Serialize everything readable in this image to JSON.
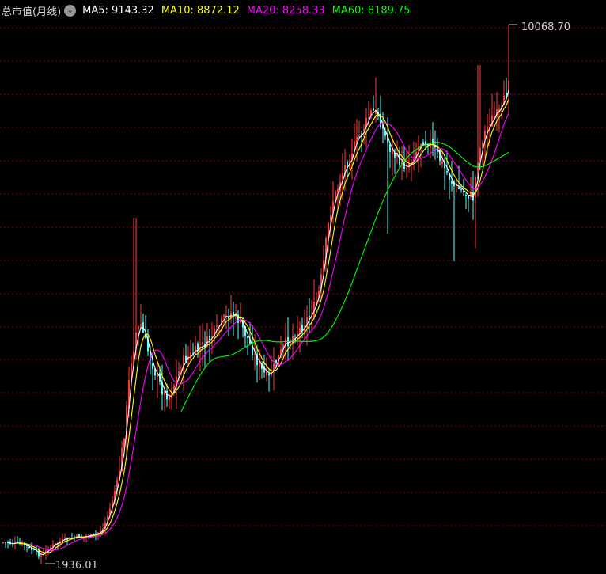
{
  "indicator": {
    "title": "总市值(月线)",
    "settings_icon": "chevron-down-circle-icon"
  },
  "legend": [
    {
      "label": "MA5: 9143.32",
      "color": "#ffffff"
    },
    {
      "label": "MA10: 8872.12",
      "color": "#ffff00"
    },
    {
      "label": "MA20: 8258.33",
      "color": "#ff00ff"
    },
    {
      "label": "MA60: 8189.75",
      "color": "#00ff00"
    }
  ],
  "colors": {
    "background": "#000000",
    "grid": "#8b0000",
    "up": "#ff3a3a",
    "down": "#54ffff",
    "annotation": "#c8c8c8"
  },
  "chart_data": {
    "type": "candlestick",
    "y_max_label": "10068.70",
    "y_min_label": "1936.01",
    "grid": "dashed horizontal",
    "scale": "log"
  }
}
